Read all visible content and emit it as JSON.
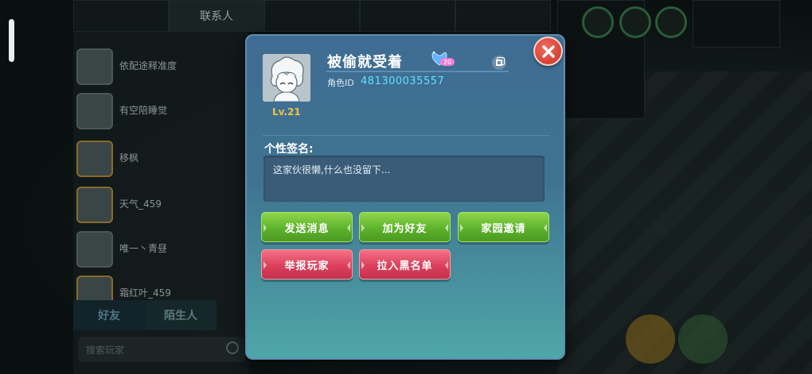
{
  "background": {
    "tabs": [
      "",
      "联系人",
      "",
      "",
      ""
    ],
    "contacts": [
      {
        "name": "依配途释准度",
        "sub": ""
      },
      {
        "name": "有空陪睡觉",
        "sub": ""
      },
      {
        "name": "移枫",
        "sub": ""
      },
      {
        "name": "天气_459",
        "sub": ""
      },
      {
        "name": "唯一丶青昼",
        "sub": ""
      },
      {
        "name": "霜红叶_459",
        "sub": ""
      }
    ],
    "bottom_tabs": [
      "好友",
      "陌生人"
    ],
    "search_placeholder": "搜索玩家"
  },
  "profile": {
    "name": "被偷就受着",
    "level": "Lv.21",
    "id_label": "角色ID",
    "id_value": "481300035557",
    "badge_text": "20"
  },
  "signature": {
    "title": "个性签名:",
    "text": "这家伙很懒,什么也没留下..."
  },
  "buttons": {
    "send_message": "发送消息",
    "add_friend": "加为好友",
    "home_invite": "家园邀请",
    "report_player": "举报玩家",
    "blacklist": "拉入黑名单"
  },
  "colors": {
    "accent_id": "#5ee0ff",
    "level": "#f0c24a",
    "green_button": "#5db22c",
    "red_button": "#dc3f5b",
    "close_button": "#d9402f"
  }
}
